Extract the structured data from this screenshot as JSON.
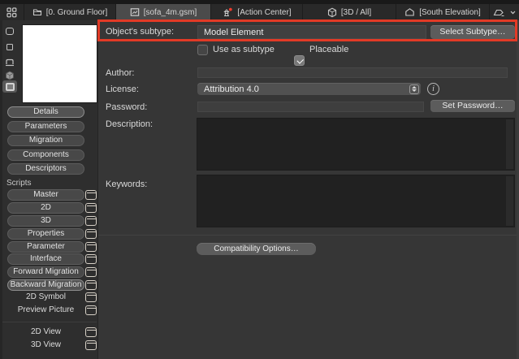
{
  "tabbar": {
    "tabs": [
      {
        "label": "[0. Ground Floor]"
      },
      {
        "label": "[sofa_4m.gsm]"
      },
      {
        "label": "[Action Center]"
      },
      {
        "label": "[3D / All]"
      },
      {
        "label": "[South Elevation]"
      }
    ]
  },
  "sidebar": {
    "pages": [
      "Details",
      "Parameters",
      "Migration",
      "Components",
      "Descriptors"
    ],
    "scripts_label": "Scripts",
    "scripts": [
      "Master",
      "2D",
      "3D",
      "Properties",
      "Parameter",
      "Interface",
      "Forward Migration",
      "Backward Migration"
    ],
    "symbol_items": [
      "2D Symbol",
      "Preview Picture"
    ],
    "view_items": [
      "2D View",
      "3D View"
    ]
  },
  "main": {
    "subtype_label": "Object's subtype:",
    "subtype_value": "Model Element",
    "select_subtype_button": "Select Subtype…",
    "use_as_subtype_label": "Use as subtype",
    "placeable_label": "Placeable",
    "author_label": "Author:",
    "author_value": "",
    "license_label": "License:",
    "license_value": "Attribution 4.0",
    "password_label": "Password:",
    "password_value": "",
    "set_password_button": "Set Password…",
    "description_label": "Description:",
    "description_value": "",
    "keywords_label": "Keywords:",
    "keywords_value": "",
    "compatibility_button": "Compatibility Options…"
  },
  "icons": {
    "info_glyph": "i"
  },
  "state": {
    "selected_tab": "[sofa_4m.gsm]",
    "use_as_subtype_checked": false,
    "placeable_checked": true,
    "highlighted_page": "Details",
    "highlighted_script": "Backward Migration"
  },
  "colors": {
    "annotation_red": "#e23a26",
    "badge_red": "#ef3b2d",
    "selected_tab_bg": "#4b4b4b",
    "sidebar_bg": "#2e2e2e",
    "main_bg": "#363636"
  }
}
